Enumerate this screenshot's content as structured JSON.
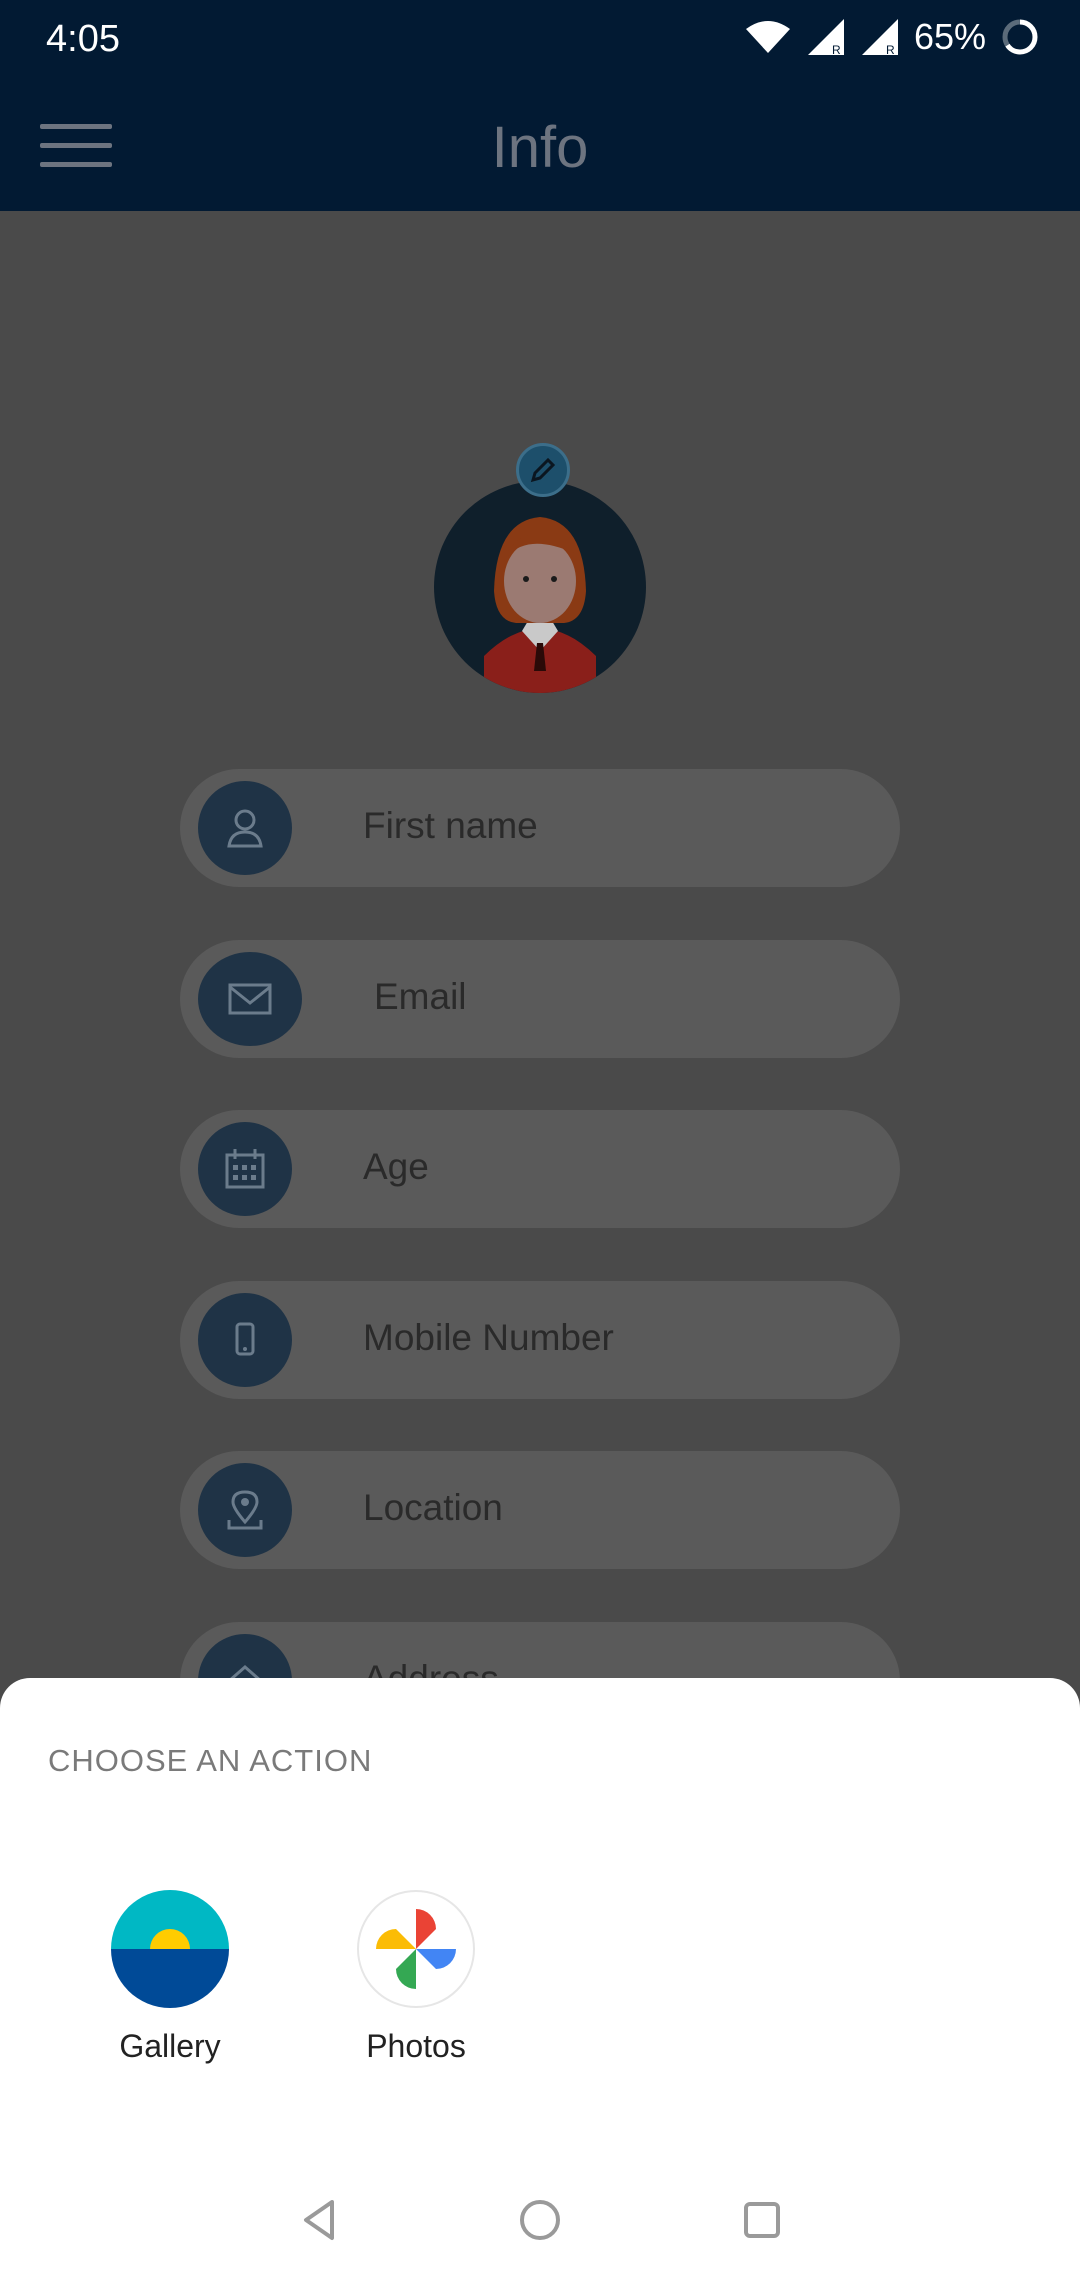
{
  "status_bar": {
    "time": "4:05",
    "battery_percent": "65%",
    "icons": [
      "wifi-icon",
      "signal-roaming-icon",
      "signal-roaming-icon",
      "battery-ring-icon"
    ]
  },
  "app_bar": {
    "title": "Info",
    "menu_icon": "hamburger-menu-icon"
  },
  "form": {
    "fields": [
      {
        "placeholder": "First name",
        "icon": "person-icon"
      },
      {
        "placeholder": "Email",
        "icon": "mail-icon"
      },
      {
        "placeholder": "Age",
        "icon": "calendar-icon"
      },
      {
        "placeholder": "Mobile Number",
        "icon": "phone-icon"
      },
      {
        "placeholder": "Location",
        "icon": "location-pin-icon"
      },
      {
        "placeholder": "Address",
        "icon": "home-icon"
      }
    ]
  },
  "sheet": {
    "title": "CHOOSE AN ACTION",
    "options": [
      {
        "label": "Gallery",
        "icon": "gallery-icon"
      },
      {
        "label": "Photos",
        "icon": "google-photos-icon"
      }
    ]
  },
  "colors": {
    "app_bar": "#021a33",
    "scrim_bg": "#4a4a4a",
    "field_bg": "#5a5a5a",
    "field_icon_bg": "#1f3346"
  }
}
